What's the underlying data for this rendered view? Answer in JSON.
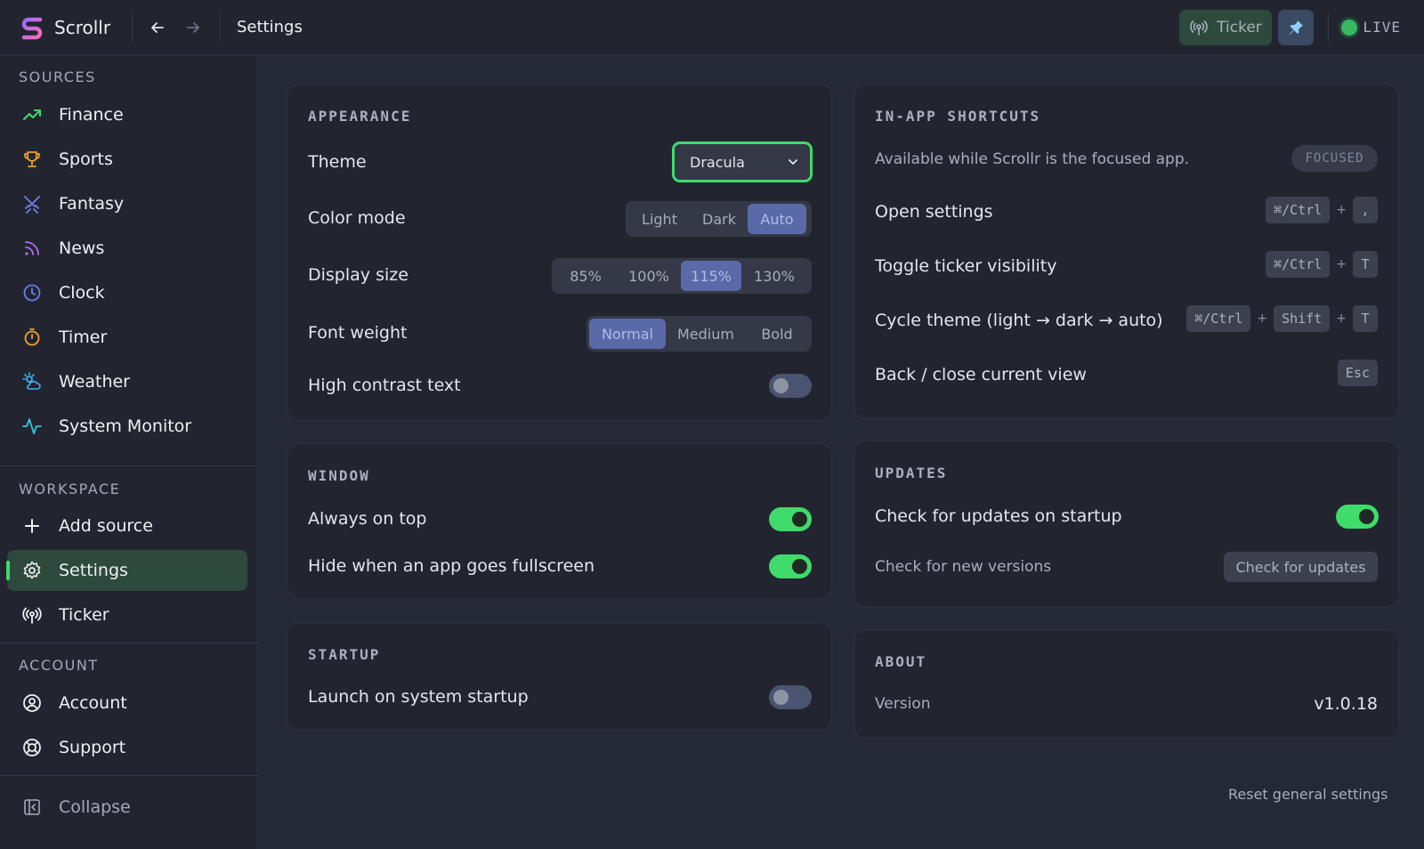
{
  "app": {
    "name": "Scrollr"
  },
  "header": {
    "title": "Settings",
    "ticker_label": "Ticker",
    "live_label": "LIVE"
  },
  "sidebar": {
    "sources_label": "SOURCES",
    "sources": [
      {
        "label": "Finance",
        "icon": "trending-up-icon"
      },
      {
        "label": "Sports",
        "icon": "trophy-icon"
      },
      {
        "label": "Fantasy",
        "icon": "swords-icon"
      },
      {
        "label": "News",
        "icon": "rss-icon"
      },
      {
        "label": "Clock",
        "icon": "clock-icon"
      },
      {
        "label": "Timer",
        "icon": "timer-icon"
      },
      {
        "label": "Weather",
        "icon": "weather-icon"
      },
      {
        "label": "System Monitor",
        "icon": "activity-icon"
      }
    ],
    "workspace_label": "WORKSPACE",
    "workspace": [
      {
        "label": "Add source",
        "icon": "plus-icon"
      },
      {
        "label": "Settings",
        "icon": "gear-icon",
        "active": true
      },
      {
        "label": "Ticker",
        "icon": "broadcast-icon"
      }
    ],
    "account_label": "ACCOUNT",
    "account": [
      {
        "label": "Account",
        "icon": "user-circle-icon"
      },
      {
        "label": "Support",
        "icon": "lifebuoy-icon"
      }
    ],
    "collapse_label": "Collapse"
  },
  "appearance": {
    "title": "APPEARANCE",
    "theme_label": "Theme",
    "theme_value": "Dracula",
    "color_mode_label": "Color mode",
    "color_modes": [
      "Light",
      "Dark",
      "Auto"
    ],
    "color_mode_selected": "Auto",
    "display_size_label": "Display size",
    "display_sizes": [
      "85%",
      "100%",
      "115%",
      "130%"
    ],
    "display_size_selected": "115%",
    "font_weight_label": "Font weight",
    "font_weights": [
      "Normal",
      "Medium",
      "Bold"
    ],
    "font_weight_selected": "Normal",
    "high_contrast_label": "High contrast text",
    "high_contrast_on": false
  },
  "window": {
    "title": "WINDOW",
    "always_on_top_label": "Always on top",
    "always_on_top_on": true,
    "hide_fullscreen_label": "Hide when an app goes fullscreen",
    "hide_fullscreen_on": true
  },
  "startup": {
    "title": "STARTUP",
    "launch_label": "Launch on system startup",
    "launch_on": false
  },
  "shortcuts": {
    "title": "IN-APP SHORTCUTS",
    "subtitle": "Available while Scrollr is the focused app.",
    "badge": "FOCUSED",
    "items": [
      {
        "label": "Open settings",
        "keys": [
          "⌘/Ctrl",
          ","
        ]
      },
      {
        "label": "Toggle ticker visibility",
        "keys": [
          "⌘/Ctrl",
          "T"
        ]
      },
      {
        "label": "Cycle theme (light → dark → auto)",
        "keys": [
          "⌘/Ctrl",
          "Shift",
          "T"
        ]
      },
      {
        "label": "Back / close current view",
        "keys": [
          "Esc"
        ]
      }
    ]
  },
  "updates": {
    "title": "UPDATES",
    "check_startup_label": "Check for updates on startup",
    "check_startup_on": true,
    "check_new_label": "Check for new versions",
    "check_button": "Check for updates"
  },
  "about": {
    "title": "ABOUT",
    "version_label": "Version",
    "version_value": "v1.0.18"
  },
  "footer": {
    "reset_label": "Reset general settings"
  },
  "colors": {
    "accent_green": "#3fdb6b",
    "selected_segment": "#5a6aa8",
    "background": "#252835",
    "panel": "#22252f"
  }
}
